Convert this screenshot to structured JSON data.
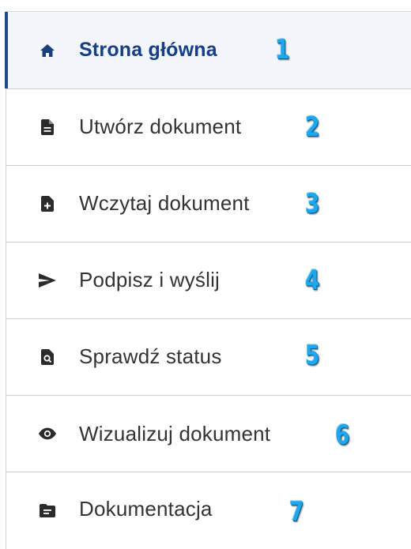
{
  "menu": {
    "items": [
      {
        "label": "Strona główna",
        "badge": "1",
        "icon": "home-icon",
        "active": true
      },
      {
        "label": "Utwórz dokument",
        "badge": "2",
        "icon": "document-icon",
        "active": false
      },
      {
        "label": "Wczytaj dokument",
        "badge": "3",
        "icon": "document-add-icon",
        "active": false
      },
      {
        "label": "Podpisz i wyślij",
        "badge": "4",
        "icon": "send-icon",
        "active": false
      },
      {
        "label": "Sprawdź status",
        "badge": "5",
        "icon": "document-search-icon",
        "active": false
      },
      {
        "label": "Wizualizuj dokument",
        "badge": "6",
        "icon": "eye-icon",
        "active": false
      },
      {
        "label": "Dokumentacja",
        "badge": "7",
        "icon": "folder-icon",
        "active": false
      }
    ]
  },
  "colors": {
    "active_text": "#153e86",
    "active_bar": "#1b4a8f",
    "active_background": "#f2f5fa",
    "text": "#333333",
    "icon": "#2b2b2b",
    "badge": "#1ea7ec"
  }
}
